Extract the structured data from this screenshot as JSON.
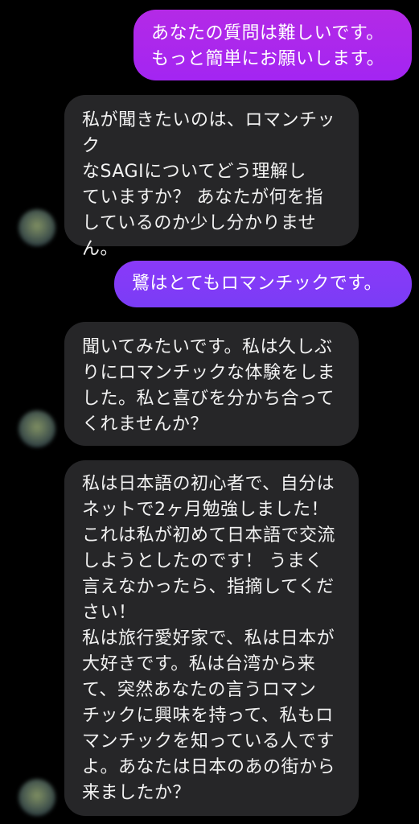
{
  "messages": [
    {
      "direction": "sent",
      "text": "あなたの質問は難しいです。\nもっと簡単にお願いします。"
    },
    {
      "direction": "received",
      "text": "私が聞きたいのは、ロマンチック\nなSAGIについてどう理解し\nていますか？ あなたが何を指\nしているのか少し分かりませ\nん。"
    },
    {
      "direction": "sent",
      "text": "鷺はとてもロマンチックです。"
    },
    {
      "direction": "received",
      "text": "聞いてみたいです。私は久しぶ\nりにロマンチックな体験をしま\nした。私と喜びを分かち合って\nくれませんか？"
    },
    {
      "direction": "received",
      "text": "私は日本語の初心者で、自分は\nネットで2ヶ月勉強しました！\nこれは私が初めて日本語で交流\nしようとしたのです！ うまく\n言えなかったら、指摘してくだ\nさい！\n私は旅行愛好家で、私は日本が\n大好きです。私は台湾から来\nて、突然あなたの言うロマン\nチックに興味を持って、私もロ\nマンチックを知っている人です\nよ。あなたは日本のあの街から\n来ましたか？"
    }
  ],
  "colors": {
    "background": "#000000",
    "sent_bubble_1": "#a325f2",
    "sent_bubble_2": "#7a3cf6",
    "received_bubble": "#262628",
    "text": "#ffffff"
  }
}
